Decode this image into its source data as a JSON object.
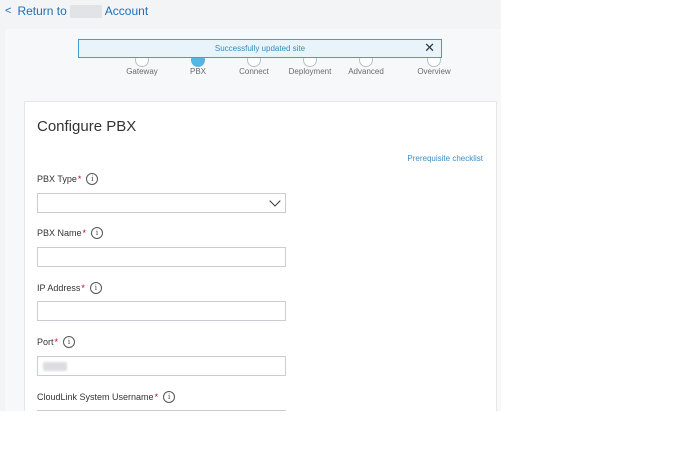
{
  "topbar": {
    "back_chevron": "<",
    "back_prefix": "Return to",
    "back_suffix": "Account"
  },
  "toast": {
    "message": "Successfully updated site",
    "close_glyph": "✕"
  },
  "stepper": {
    "steps": [
      "Gateway",
      "PBX",
      "Connect",
      "Deployment",
      "Advanced",
      "Overview"
    ],
    "active_step": "PBX"
  },
  "card": {
    "title": "Configure PBX",
    "prereq_link": "Prerequisite checklist",
    "fields": [
      {
        "label": "PBX Type",
        "required": "*",
        "info": "i",
        "value": ""
      },
      {
        "label": "PBX Name",
        "required": "*",
        "info": "i",
        "value": ""
      },
      {
        "label": "IP Address",
        "required": "*",
        "info": "i",
        "value": ""
      },
      {
        "label": "Port",
        "required": "*",
        "info": "i",
        "value": ""
      },
      {
        "label": "CloudLink System Username",
        "required": "*",
        "info": "i",
        "value": ""
      }
    ]
  },
  "colors": {
    "link": "#1f6eb5",
    "accent": "#3ea2cf",
    "required": "#d0021b"
  }
}
